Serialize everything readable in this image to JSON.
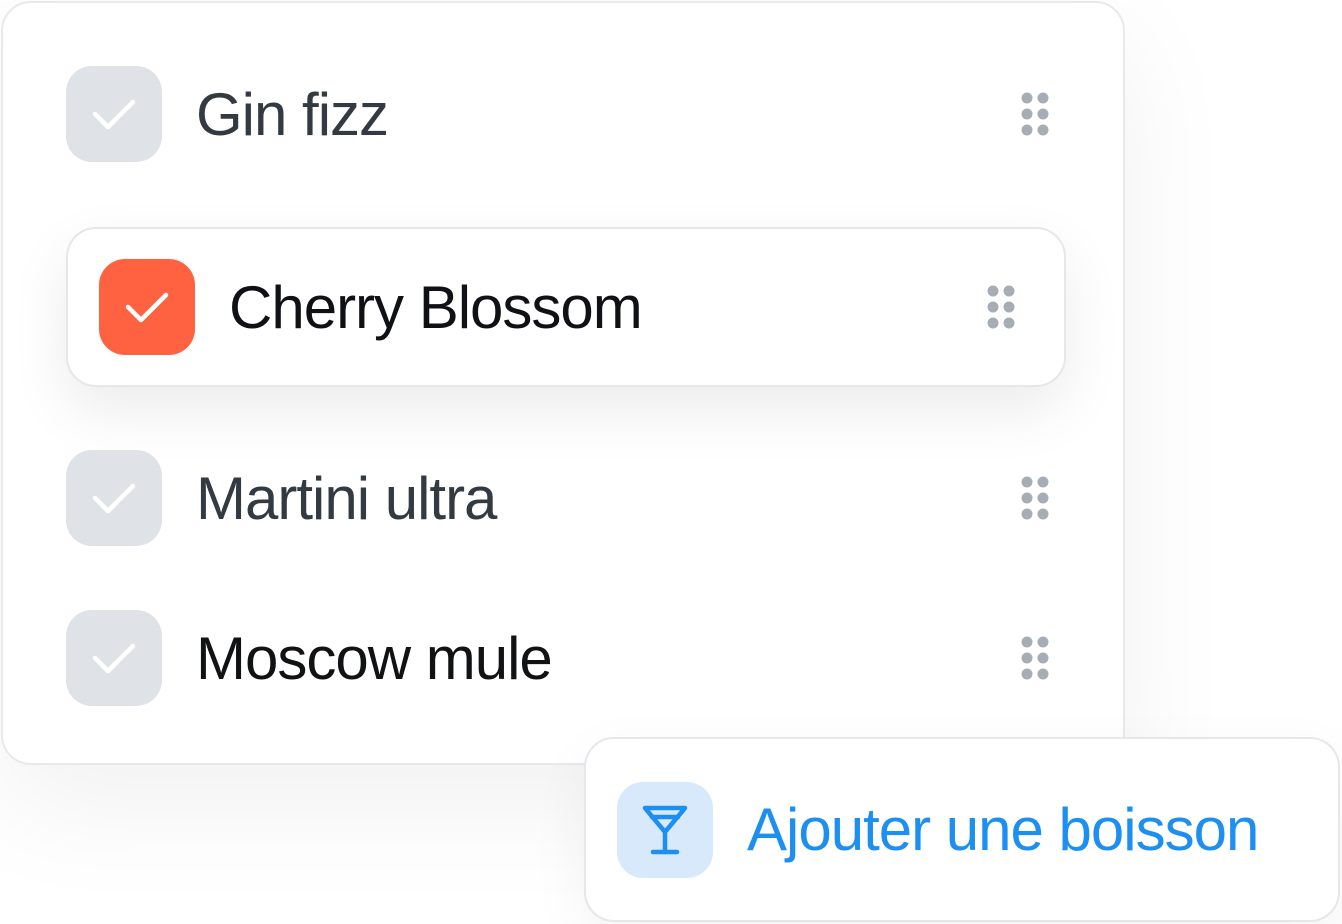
{
  "drinks": [
    {
      "label": "Gin fizz",
      "checked": false
    },
    {
      "label": "Cherry Blossom",
      "checked": true
    },
    {
      "label": "Martini ultra",
      "checked": false
    },
    {
      "label": "Moscow mule",
      "checked": false
    }
  ],
  "add_button": {
    "label": "Ajouter une boisson",
    "icon": "cocktail-glass-icon"
  },
  "colors": {
    "checked_accent": "#ff6240",
    "unchecked_box": "#dfe2e6",
    "add_accent": "#1d8ff0",
    "add_icon_bg": "#d7e9fb"
  }
}
